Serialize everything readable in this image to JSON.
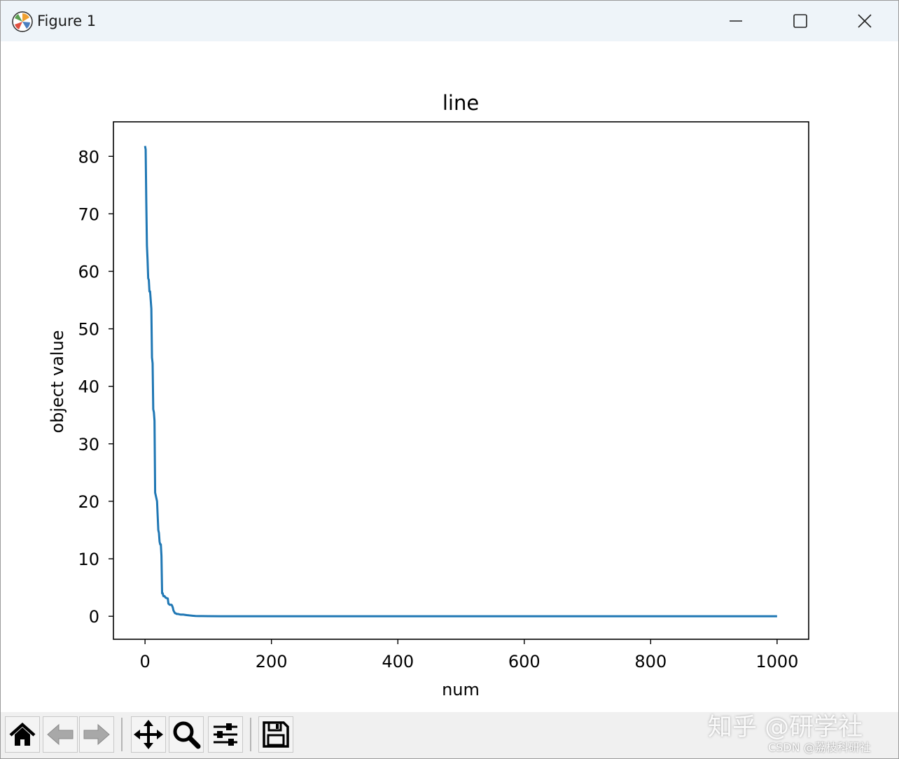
{
  "window": {
    "title": "Figure 1",
    "app_icon": "matplotlib-icon",
    "controls": {
      "minimize": "minimize-icon",
      "maximize": "maximize-icon",
      "close": "close-icon"
    }
  },
  "chart_data": {
    "type": "line",
    "title": "line",
    "xlabel": "num",
    "ylabel": "object value",
    "xlim": [
      -50,
      1050
    ],
    "ylim": [
      -4,
      86
    ],
    "xticks": [
      0,
      200,
      400,
      600,
      800,
      1000
    ],
    "yticks": [
      0,
      10,
      20,
      30,
      40,
      50,
      60,
      70,
      80
    ],
    "grid": false,
    "series": [
      {
        "color": "#1f77b4",
        "x": [
          0,
          1,
          2,
          3,
          4,
          5,
          6,
          7,
          8,
          9,
          10,
          11,
          12,
          13,
          14,
          15,
          16,
          17,
          18,
          19,
          20,
          21,
          22,
          23,
          24,
          25,
          26,
          27,
          28,
          29,
          30,
          31,
          32,
          33,
          34,
          35,
          36,
          37,
          38,
          39,
          40,
          41,
          42,
          43,
          44,
          45,
          46,
          47,
          48,
          49,
          50,
          52,
          54,
          56,
          58,
          60,
          63,
          66,
          70,
          75,
          80,
          85,
          90,
          100,
          120,
          150,
          200,
          300,
          400,
          500,
          600,
          700,
          800,
          900,
          1000
        ],
        "y": [
          81.8,
          81.2,
          72.0,
          64.5,
          62.0,
          58.8,
          58.5,
          56.5,
          56.5,
          55.0,
          53.5,
          45.0,
          44.0,
          36.0,
          35.5,
          34.0,
          21.5,
          21.0,
          20.5,
          20.0,
          17.5,
          15.0,
          14.5,
          13.0,
          12.5,
          12.5,
          10.5,
          4.0,
          4.0,
          3.5,
          3.5,
          3.5,
          3.3,
          3.2,
          3.2,
          3.1,
          3.1,
          2.2,
          2.1,
          2.0,
          2.0,
          2.0,
          2.0,
          1.8,
          1.5,
          1.0,
          0.8,
          0.6,
          0.5,
          0.5,
          0.4,
          0.4,
          0.35,
          0.3,
          0.3,
          0.3,
          0.25,
          0.2,
          0.15,
          0.1,
          0.05,
          0.04,
          0.03,
          0.02,
          0.01,
          0.0,
          0.0,
          0.0,
          0.0,
          0.0,
          0.0,
          0.0,
          0.0,
          0.0,
          0.0
        ]
      }
    ]
  },
  "toolbar": {
    "buttons": [
      {
        "name": "home-button",
        "icon": "home-icon"
      },
      {
        "name": "back-button",
        "icon": "arrow-left-icon"
      },
      {
        "name": "forward-button",
        "icon": "arrow-right-icon"
      },
      {
        "name": "pan-button",
        "icon": "move-icon"
      },
      {
        "name": "zoom-button",
        "icon": "magnifier-icon"
      },
      {
        "name": "configure-subplots-button",
        "icon": "sliders-icon"
      },
      {
        "name": "save-button",
        "icon": "floppy-disk-icon"
      }
    ]
  },
  "watermark": {
    "primary": "知乎 @研学社",
    "secondary": "CSDN @荔枝科研社"
  }
}
